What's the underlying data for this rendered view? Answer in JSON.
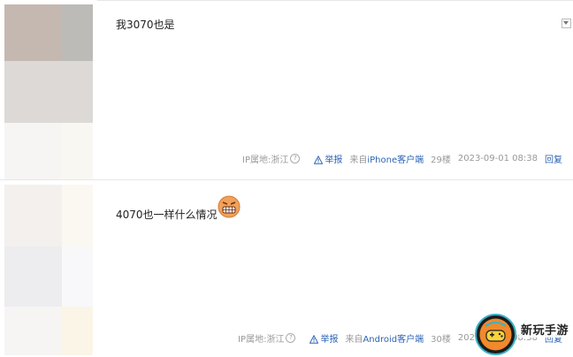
{
  "posts": [
    {
      "content": "我3070也是",
      "ip_label": "IP属地:浙江",
      "report_label": "举报",
      "source_prefix": "来自",
      "source_client": "iPhone客户端",
      "floor": "29楼",
      "timestamp": "2023-09-01 08:38",
      "reply_label": "回复"
    },
    {
      "content": "4070也一样什么情况",
      "emoji_icon": "grimace-emoji-icon",
      "ip_label": "IP属地:浙江",
      "report_label": "举报",
      "source_prefix": "来自",
      "source_client": "Android客户端",
      "floor": "30楼",
      "timestamp": "2023-09-01 08:38",
      "reply_label": "回复"
    }
  ],
  "watermark": {
    "text": "新玩手游"
  },
  "colors": {
    "link": "#2d64b3",
    "meta": "#999999",
    "divider": "#e8e8e8"
  }
}
